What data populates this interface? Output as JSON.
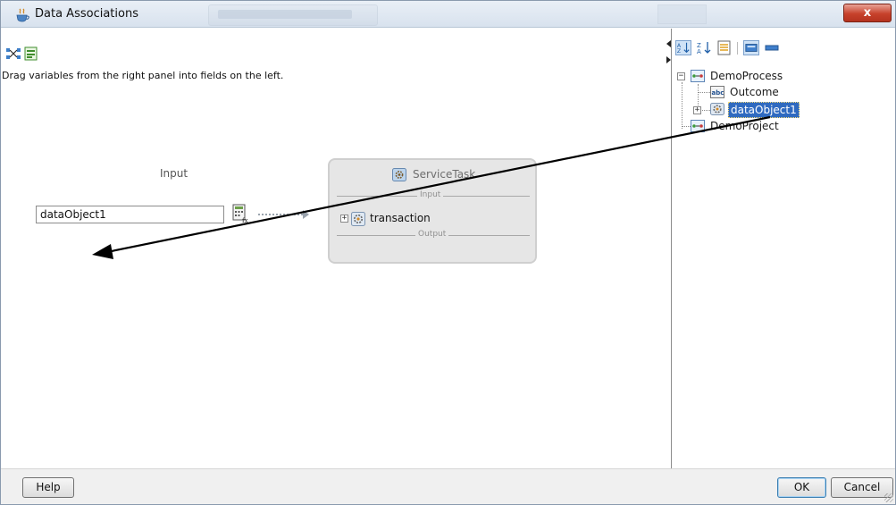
{
  "window": {
    "title": "Data Associations",
    "close_label": "x",
    "title_icon": "coffee-cup-icon"
  },
  "left_panel": {
    "toolbar_icons": [
      "auto-map-icon",
      "expression-builder-icon"
    ],
    "instruction": "Drag variables from the right panel into fields on the left.",
    "input_heading": "Input",
    "input_field_value": "dataObject1",
    "task": {
      "title": "ServiceTask",
      "input_label": "Input",
      "output_label": "Output",
      "argument": "transaction",
      "expander": "+"
    }
  },
  "right_panel": {
    "toolbar_icons": [
      "sort-ascending-icon",
      "sort-descending-icon",
      "list-view-icon",
      "show-types-icon",
      "collapse-all-icon"
    ],
    "tree": [
      {
        "label": "DemoProcess",
        "icon": "process-icon",
        "expander": "−"
      },
      {
        "label": "Outcome",
        "icon": "string-type-icon"
      },
      {
        "label": "dataObject1",
        "icon": "data-object-icon",
        "expander": "+",
        "selected": true
      },
      {
        "label": "DemoProject",
        "icon": "project-icon"
      }
    ]
  },
  "footer": {
    "help_label": "Help",
    "ok_label": "OK",
    "cancel_label": "Cancel"
  },
  "colors": {
    "selection": "#2f6ac0",
    "close_button": "#c7412b",
    "task_box": "#e6e6e6",
    "annotation_arrow": "#000000"
  }
}
